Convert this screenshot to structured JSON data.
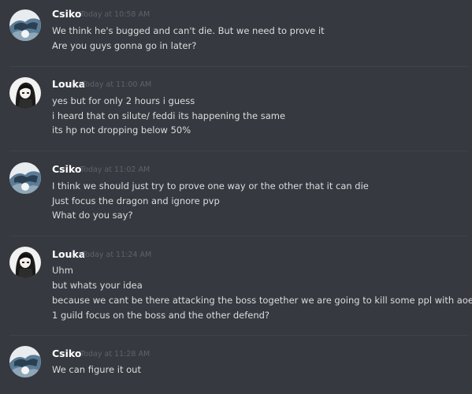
{
  "messages": [
    {
      "author": "Csiko",
      "avatar": "csiko-avatar",
      "timestamp": "Today at 10:58 AM",
      "lines": [
        "We think he's bugged and can't die. But we need to prove it",
        "Are you guys gonna go in later?"
      ]
    },
    {
      "author": "Louka",
      "avatar": "louka-avatar",
      "timestamp": "Today at 11:00 AM",
      "lines": [
        "yes but for only 2 hours i guess",
        "i heard that on silute/ feddi its happening the same",
        "its hp not dropping below 50%"
      ]
    },
    {
      "author": "Csiko",
      "avatar": "csiko-avatar",
      "timestamp": "Today at 11:02 AM",
      "lines": [
        "I think we should just try to prove one way or the other that it can die",
        "Just focus the dragon and ignore pvp",
        "What do you say?"
      ]
    },
    {
      "author": "Louka",
      "avatar": "louka-avatar",
      "timestamp": "Today at 11:24 AM",
      "lines": [
        "Uhm",
        "but whats your idea",
        "because we cant be there attacking the boss together we are going to kill some ppl with aoe",
        "1 guild focus on the boss and the other defend?"
      ]
    },
    {
      "author": "Csiko",
      "avatar": "csiko-avatar",
      "timestamp": "Today at 11:28 AM",
      "lines": [
        "We can figure it out"
      ]
    }
  ],
  "colors": {
    "background": "#36393f",
    "divider": "#40434a",
    "username": "#ffffff",
    "timestamp": "#5f6269",
    "message_text": "#dcddde"
  }
}
